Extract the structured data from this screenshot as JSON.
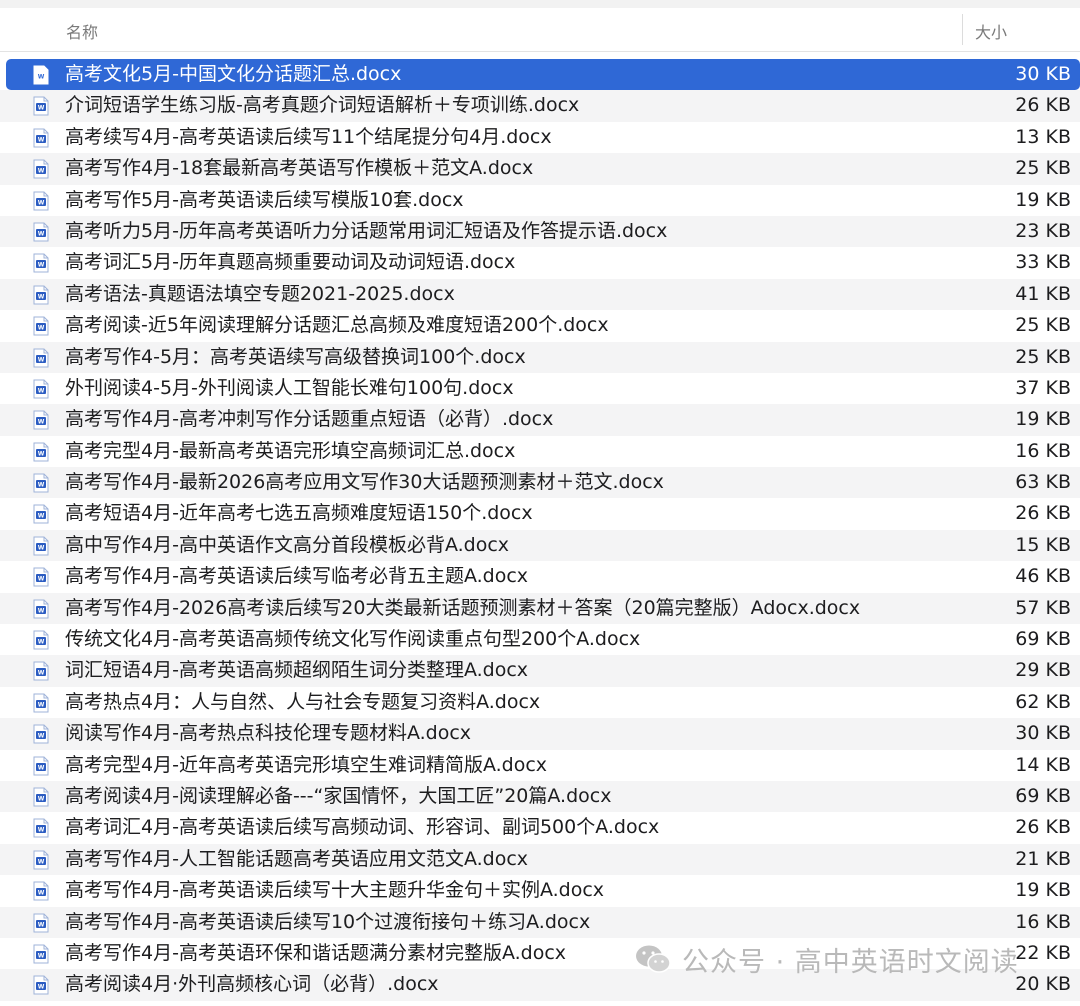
{
  "header": {
    "name_label": "名称",
    "size_label": "大小"
  },
  "files": [
    {
      "name": "高考文化5月-中国文化分话题汇总.docx",
      "size": "30 KB",
      "selected": true
    },
    {
      "name": "介词短语学生练习版-高考真题介词短语解析＋专项训练.docx",
      "size": "26 KB"
    },
    {
      "name": "高考续写4月-高考英语读后续写11个结尾提分句4月.docx",
      "size": "13 KB"
    },
    {
      "name": "高考写作4月-18套最新高考英语写作模板＋范文A.docx",
      "size": "25 KB"
    },
    {
      "name": "高考写作5月-高考英语读后续写模版10套.docx",
      "size": "19 KB"
    },
    {
      "name": "高考听力5月-历年高考英语听力分话题常用词汇短语及作答提示语.docx",
      "size": "23 KB"
    },
    {
      "name": "高考词汇5月-历年真题高频重要动词及动词短语.docx",
      "size": "33 KB"
    },
    {
      "name": "高考语法-真题语法填空专题2021-2025.docx",
      "size": "41 KB"
    },
    {
      "name": "高考阅读-近5年阅读理解分话题汇总高频及难度短语200个.docx",
      "size": "25 KB"
    },
    {
      "name": "高考写作4-5月：高考英语续写高级替换词100个.docx",
      "size": "25 KB"
    },
    {
      "name": "外刊阅读4-5月-外刊阅读人工智能长难句100句.docx",
      "size": "37 KB"
    },
    {
      "name": "高考写作4月-高考冲刺写作分话题重点短语（必背）.docx",
      "size": "19 KB"
    },
    {
      "name": "高考完型4月-最新高考英语完形填空高频词汇总.docx",
      "size": "16 KB"
    },
    {
      "name": "高考写作4月-最新2026高考应用文写作30大话题预测素材＋范文.docx",
      "size": "63 KB"
    },
    {
      "name": "高考短语4月-近年高考七选五高频难度短语150个.docx",
      "size": "26 KB"
    },
    {
      "name": "高中写作4月-高中英语作文高分首段模板必背A.docx",
      "size": "15 KB"
    },
    {
      "name": "高考写作4月-高考英语读后续写临考必背五主题A.docx",
      "size": "46 KB"
    },
    {
      "name": "高考写作4月-2026高考读后续写20大类最新话题预测素材＋答案（20篇完整版）Adocx.docx",
      "size": "57 KB"
    },
    {
      "name": "传统文化4月-高考英语高频传统文化写作阅读重点句型200个A.docx",
      "size": "69 KB"
    },
    {
      "name": "词汇短语4月-高考英语高频超纲陌生词分类整理A.docx",
      "size": "29 KB"
    },
    {
      "name": "高考热点4月：人与自然、人与社会专题复习资料A.docx",
      "size": "62 KB"
    },
    {
      "name": "阅读写作4月-高考热点科技伦理专题材料A.docx",
      "size": "30 KB"
    },
    {
      "name": "高考完型4月-近年高考英语完形填空生难词精简版A.docx",
      "size": "14 KB"
    },
    {
      "name": "高考阅读4月-阅读理解必备---“家国情怀，大国工匠”20篇A.docx",
      "size": "69 KB"
    },
    {
      "name": "高考词汇4月-高考英语读后续写高频动词、形容词、副词500个A.docx",
      "size": "26 KB"
    },
    {
      "name": "高考写作4月-人工智能话题高考英语应用文范文A.docx",
      "size": "21 KB"
    },
    {
      "name": "高考写作4月-高考英语读后续写十大主题升华金句＋实例A.docx",
      "size": "19 KB"
    },
    {
      "name": "高考写作4月-高考英语读后续写10个过渡衔接句＋练习A.docx",
      "size": "16 KB"
    },
    {
      "name": "高考写作4月-高考英语环保和谐话题满分素材完整版A.docx",
      "size": "22 KB"
    },
    {
      "name": "高考阅读4月·外刊高频核心词（必背）.docx",
      "size": "20 KB"
    }
  ],
  "watermark": {
    "text": "公众号 · 高中英语时文阅读"
  },
  "icons": {
    "file": "word-doc-icon",
    "watermark": "wechat-icon"
  },
  "colors": {
    "selection": "#2f68d6",
    "doc_icon": "#2b5cc2",
    "stripe": "#f4f4f5"
  }
}
